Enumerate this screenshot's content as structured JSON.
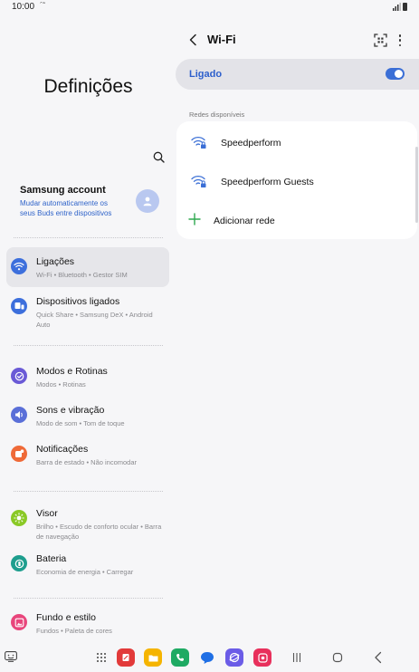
{
  "status_bar": {
    "time": "10:00",
    "indicator": "´˜"
  },
  "left": {
    "title": "Definições",
    "search_icon": "search-icon",
    "account": {
      "name": "Samsung account",
      "description": "Mudar automaticamente os seus Buds entre dispositivos"
    },
    "items": [
      {
        "title": "Ligações",
        "subtitle": "Wi-Fi  •  Bluetooth  •  Gestor SIM",
        "icon": "wifi-icon",
        "color": "#3d6fdc"
      },
      {
        "title": "Dispositivos ligados",
        "subtitle": "Quick Share  •  Samsung DeX  •  Android Auto",
        "icon": "devices-icon",
        "color": "#3d6fdc"
      },
      {
        "title": "Modos e Rotinas",
        "subtitle": "Modos  •  Rotinas",
        "icon": "check-circle-icon",
        "color": "#6a5ad6"
      },
      {
        "title": "Sons e vibração",
        "subtitle": "Modo de som  •  Tom de toque",
        "icon": "speaker-icon",
        "color": "#5a6fd8"
      },
      {
        "title": "Notificações",
        "subtitle": "Barra de estado  •  Não incomodar",
        "icon": "notification-icon",
        "color": "#ef6a38"
      },
      {
        "title": "Visor",
        "subtitle": "Brilho  •  Escudo de conforto ocular  •  Barra de navegação",
        "icon": "sun-icon",
        "color": "#8ac926"
      },
      {
        "title": "Bateria",
        "subtitle": "Economia de energia  •  Carregar",
        "icon": "battery-icon",
        "color": "#1e9e8e"
      },
      {
        "title": "Fundo e estilo",
        "subtitle": "Fundos  •  Paleta de cores",
        "icon": "wallpaper-icon",
        "color": "#e8467c"
      }
    ]
  },
  "right": {
    "title": "Wi-Fi",
    "toggle_label": "Ligado",
    "toggle_on": true,
    "section_label": "Redes disponíveis",
    "networks": [
      {
        "name": "Speedperform",
        "icon": "wifi-lock-icon"
      },
      {
        "name": "Speedperform Guests",
        "icon": "wifi-lock-icon"
      }
    ],
    "add_label": "Adicionar rede"
  },
  "accent_color": "#3b6fd6"
}
